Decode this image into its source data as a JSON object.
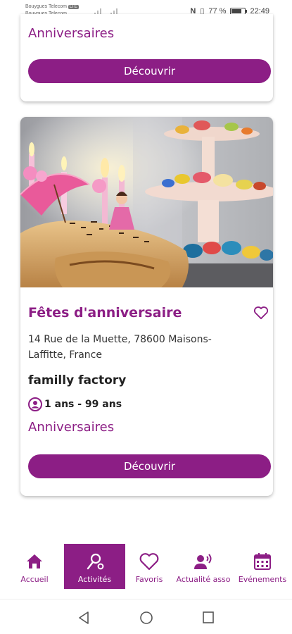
{
  "status": {
    "carrier1": "Bouygues Telecom",
    "carrier1_badge": "LTE",
    "carrier2": "Bouygues Telecom",
    "nfc": "N",
    "battery_percent": "77 %",
    "battery_level": 0.77,
    "time": "22:49"
  },
  "top_card": {
    "category": "Anniversaires",
    "button": "Découvrir"
  },
  "activity": {
    "title": "Fêtes d'anniversaire",
    "address": "14 Rue de la Muette, 78600 Maisons-Laffitte, France",
    "organizer": "familly factory",
    "age_range": "1 ans - 99 ans",
    "category": "Anniversaires",
    "button": "Découvrir"
  },
  "nav": {
    "items": [
      {
        "label": "Accueil",
        "icon": "home-icon"
      },
      {
        "label": "Activités",
        "icon": "activities-icon",
        "active": true
      },
      {
        "label": "Favoris",
        "icon": "heart-icon"
      },
      {
        "label": "Actualité asso",
        "icon": "announcement-icon"
      },
      {
        "label": "Evénements",
        "icon": "calendar-icon"
      }
    ]
  },
  "colors": {
    "accent": "#8c1e85",
    "text": "#222222"
  }
}
